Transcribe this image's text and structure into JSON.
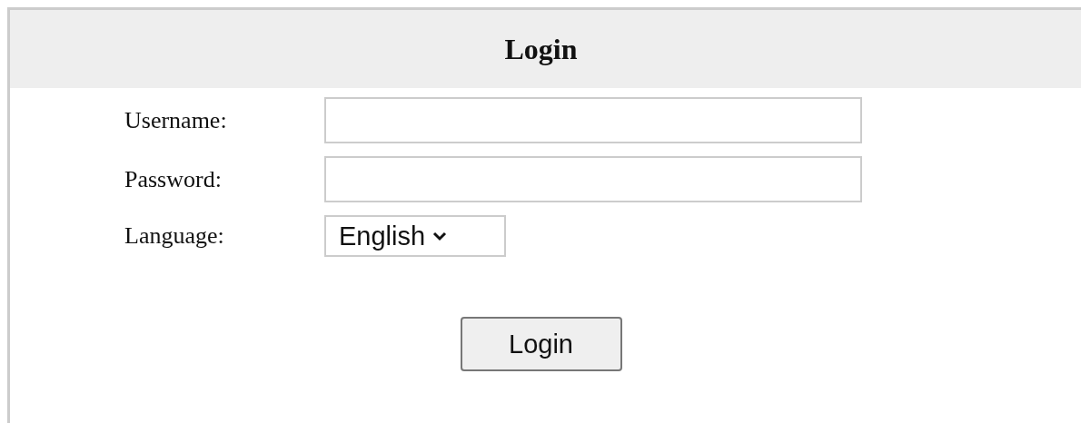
{
  "title": "Login",
  "fields": [
    {
      "kind": "text",
      "label": "Username:"
    },
    {
      "kind": "password",
      "label": "Password:"
    },
    {
      "kind": "select",
      "label": "Language:",
      "value": "English"
    }
  ],
  "button": "Login"
}
